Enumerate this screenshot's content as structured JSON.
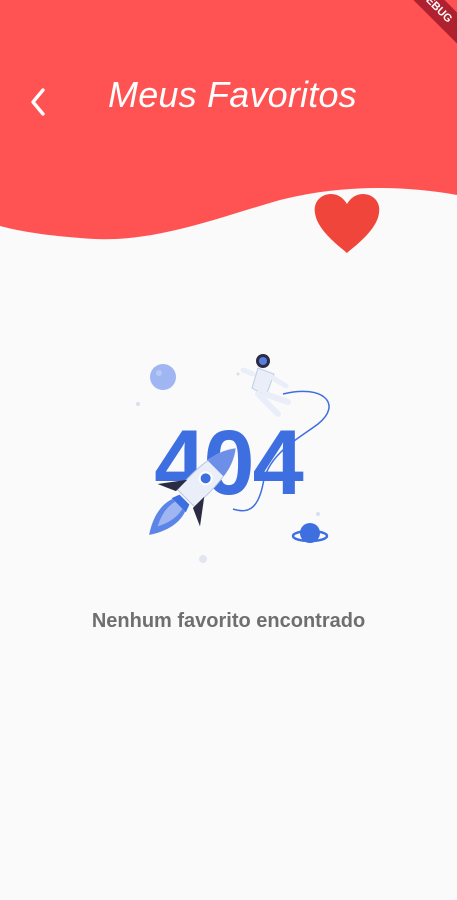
{
  "header": {
    "title": "Meus Favoritos",
    "back_icon": "chevron-left-icon",
    "color": "#ff5353"
  },
  "favorite_icon": {
    "icon": "heart-icon",
    "color": "#f0453a"
  },
  "debug_banner": {
    "label": "DEBUG"
  },
  "empty_state": {
    "illustration_text": "404",
    "message": "Nenhum favorito encontrado",
    "accent_color": "#3d6fe0"
  }
}
